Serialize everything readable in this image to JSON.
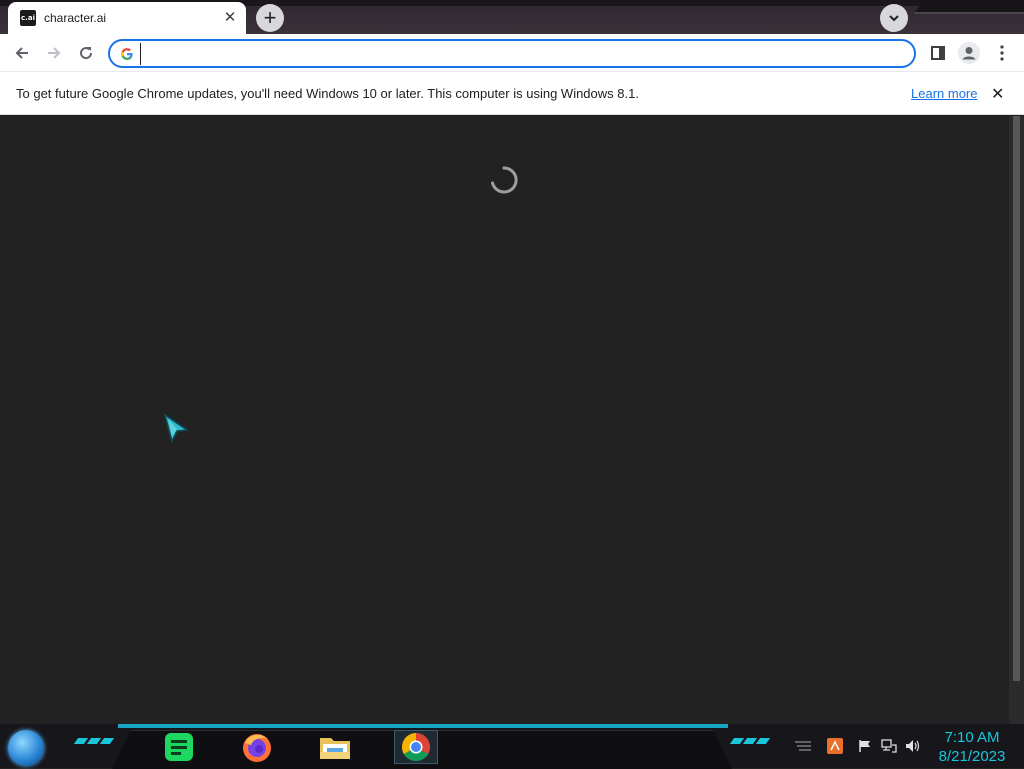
{
  "browser": {
    "tab": {
      "favicon_text": "c.ai",
      "title": "character.ai"
    },
    "omnibox": {
      "value": "",
      "placeholder": ""
    }
  },
  "infobar": {
    "message": "To get future Google Chrome updates, you'll need Windows 10 or later. This computer is using Windows 8.1.",
    "link_label": "Learn more"
  },
  "page": {
    "state": "loading"
  },
  "taskbar": {
    "apps": [
      "start-orb",
      "notes",
      "firefox",
      "file-explorer",
      "chrome"
    ],
    "clock": {
      "time": "7:10 AM",
      "date": "8/21/2023"
    }
  },
  "colors": {
    "accent_blue": "#1a73e8",
    "content_bg": "#222222",
    "taskbar_accent": "#19c6dc"
  }
}
